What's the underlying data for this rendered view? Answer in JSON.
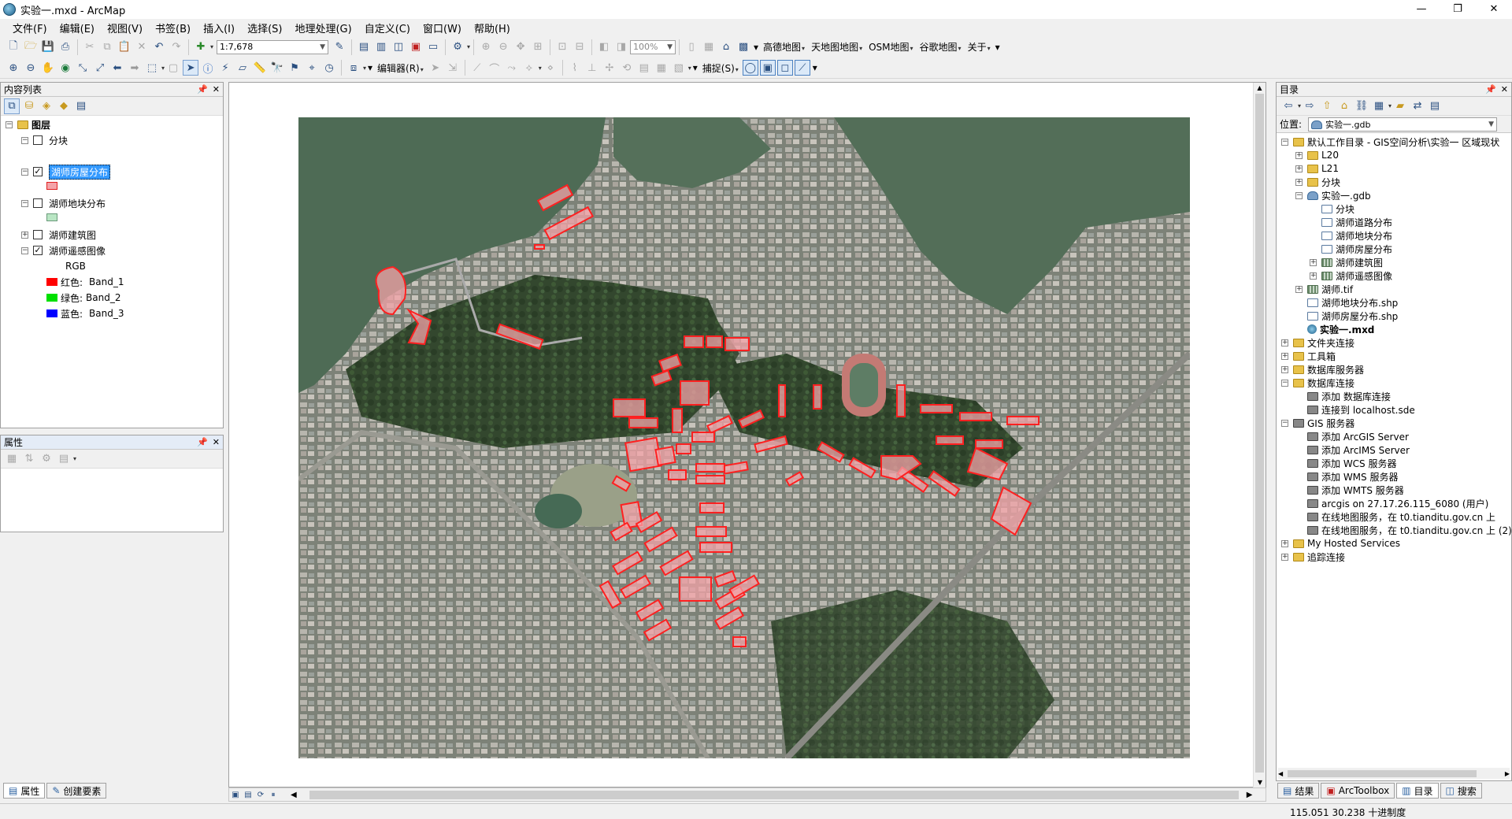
{
  "window": {
    "title": "实验一.mxd - ArcMap",
    "min": "—",
    "max": "❐",
    "close": "✕"
  },
  "menu": [
    "文件(F)",
    "编辑(E)",
    "视图(V)",
    "书签(B)",
    "插入(I)",
    "选择(S)",
    "地理处理(G)",
    "自定义(C)",
    "窗口(W)",
    "帮助(H)"
  ],
  "toolbar1": {
    "scale": "1:7,678",
    "zoom_pct": "100%",
    "basemaps": [
      "高德地图",
      "天地图地图",
      "OSM地图",
      "谷歌地图",
      "关于"
    ]
  },
  "toolbar2": {
    "editor": "编辑器(R)",
    "snapping": "捕捉(S)"
  },
  "toc": {
    "title": "内容列表",
    "pin": "ᵖ",
    "close": "✕",
    "root": "图层",
    "layers": [
      {
        "name": "分块",
        "checked": false,
        "expanded": true
      },
      {
        "name": "湖师房屋分布",
        "checked": true,
        "expanded": true,
        "selected": true,
        "swatch": "#f4a3a8"
      },
      {
        "name": "湖师地块分布",
        "checked": false,
        "expanded": true,
        "swatch": "#b9e6c4"
      },
      {
        "name": "湖师建筑图",
        "checked": false,
        "expanded": false
      },
      {
        "name": "湖师遥感图像",
        "checked": true,
        "expanded": true
      }
    ],
    "rgb_label": "RGB",
    "bands": [
      {
        "label": "红色:",
        "band": "Band_1",
        "color": "#ff0000"
      },
      {
        "label": "绿色:",
        "band": "Band_2",
        "color": "#00e000"
      },
      {
        "label": "蓝色:",
        "band": "Band_3",
        "color": "#0000ff"
      }
    ]
  },
  "props": {
    "title": "属性"
  },
  "bottom_tabs_left": [
    "属性",
    "创建要素"
  ],
  "catalog": {
    "title": "目录",
    "location_label": "位置:",
    "location_value": "实验一.gdb",
    "items": [
      {
        "text": "默认工作目录 - GIS空间分析\\实验一 区域现状",
        "icon": "folder",
        "level": 0,
        "exp": "−"
      },
      {
        "text": "L20",
        "icon": "folder",
        "level": 1,
        "exp": "+"
      },
      {
        "text": "L21",
        "icon": "folder",
        "level": 1,
        "exp": "+"
      },
      {
        "text": "分块",
        "icon": "folder",
        "level": 1,
        "exp": "+"
      },
      {
        "text": "实验一.gdb",
        "icon": "gdb",
        "level": 1,
        "exp": "−"
      },
      {
        "text": "分块",
        "icon": "fc",
        "level": 2,
        "exp": ""
      },
      {
        "text": "湖师道路分布",
        "icon": "fc",
        "level": 2,
        "exp": ""
      },
      {
        "text": "湖师地块分布",
        "icon": "fc",
        "level": 2,
        "exp": ""
      },
      {
        "text": "湖师房屋分布",
        "icon": "fc",
        "level": 2,
        "exp": ""
      },
      {
        "text": "湖师建筑图",
        "icon": "raster",
        "level": 2,
        "exp": "+"
      },
      {
        "text": "湖师遥感图像",
        "icon": "raster",
        "level": 2,
        "exp": "+"
      },
      {
        "text": "湖师.tif",
        "icon": "raster",
        "level": 1,
        "exp": "+"
      },
      {
        "text": "湖师地块分布.shp",
        "icon": "fc",
        "level": 1,
        "exp": ""
      },
      {
        "text": "湖师房屋分布.shp",
        "icon": "fc",
        "level": 1,
        "exp": ""
      },
      {
        "text": "实验一.mxd",
        "icon": "mxd",
        "level": 1,
        "exp": "",
        "bold": true
      },
      {
        "text": "文件夹连接",
        "icon": "folder",
        "level": 0,
        "exp": "+"
      },
      {
        "text": "工具箱",
        "icon": "folder",
        "level": 0,
        "exp": "+"
      },
      {
        "text": "数据库服务器",
        "icon": "folder",
        "level": 0,
        "exp": "+"
      },
      {
        "text": "数据库连接",
        "icon": "folder",
        "level": 0,
        "exp": "−"
      },
      {
        "text": "添加 数据库连接",
        "icon": "srv",
        "level": 1,
        "exp": ""
      },
      {
        "text": "连接到 localhost.sde",
        "icon": "srv",
        "level": 1,
        "exp": ""
      },
      {
        "text": "GIS 服务器",
        "icon": "srv",
        "level": 0,
        "exp": "−"
      },
      {
        "text": "添加 ArcGIS Server",
        "icon": "srv",
        "level": 1,
        "exp": ""
      },
      {
        "text": "添加 ArcIMS Server",
        "icon": "srv",
        "level": 1,
        "exp": ""
      },
      {
        "text": "添加 WCS 服务器",
        "icon": "srv",
        "level": 1,
        "exp": ""
      },
      {
        "text": "添加 WMS 服务器",
        "icon": "srv",
        "level": 1,
        "exp": ""
      },
      {
        "text": "添加 WMTS 服务器",
        "icon": "srv",
        "level": 1,
        "exp": ""
      },
      {
        "text": "arcgis on 27.17.26.115_6080 (用户)",
        "icon": "srv",
        "level": 1,
        "exp": ""
      },
      {
        "text": "在线地图服务，在 t0.tianditu.gov.cn 上",
        "icon": "srv",
        "level": 1,
        "exp": ""
      },
      {
        "text": "在线地图服务，在 t0.tianditu.gov.cn 上 (2)",
        "icon": "srv",
        "level": 1,
        "exp": ""
      },
      {
        "text": "My Hosted Services",
        "icon": "folder",
        "level": 0,
        "exp": "+"
      },
      {
        "text": "追踪连接",
        "icon": "folder",
        "level": 0,
        "exp": "+"
      }
    ]
  },
  "bottom_tabs_right": [
    "结果",
    "ArcToolbox",
    "目录",
    "搜索"
  ],
  "status": {
    "coords": "115.051  30.238 十进制度"
  },
  "colors": {
    "selection": "#3399ff",
    "feature_outline": "#ff2020",
    "feature_fill": "#f4a3a8"
  }
}
